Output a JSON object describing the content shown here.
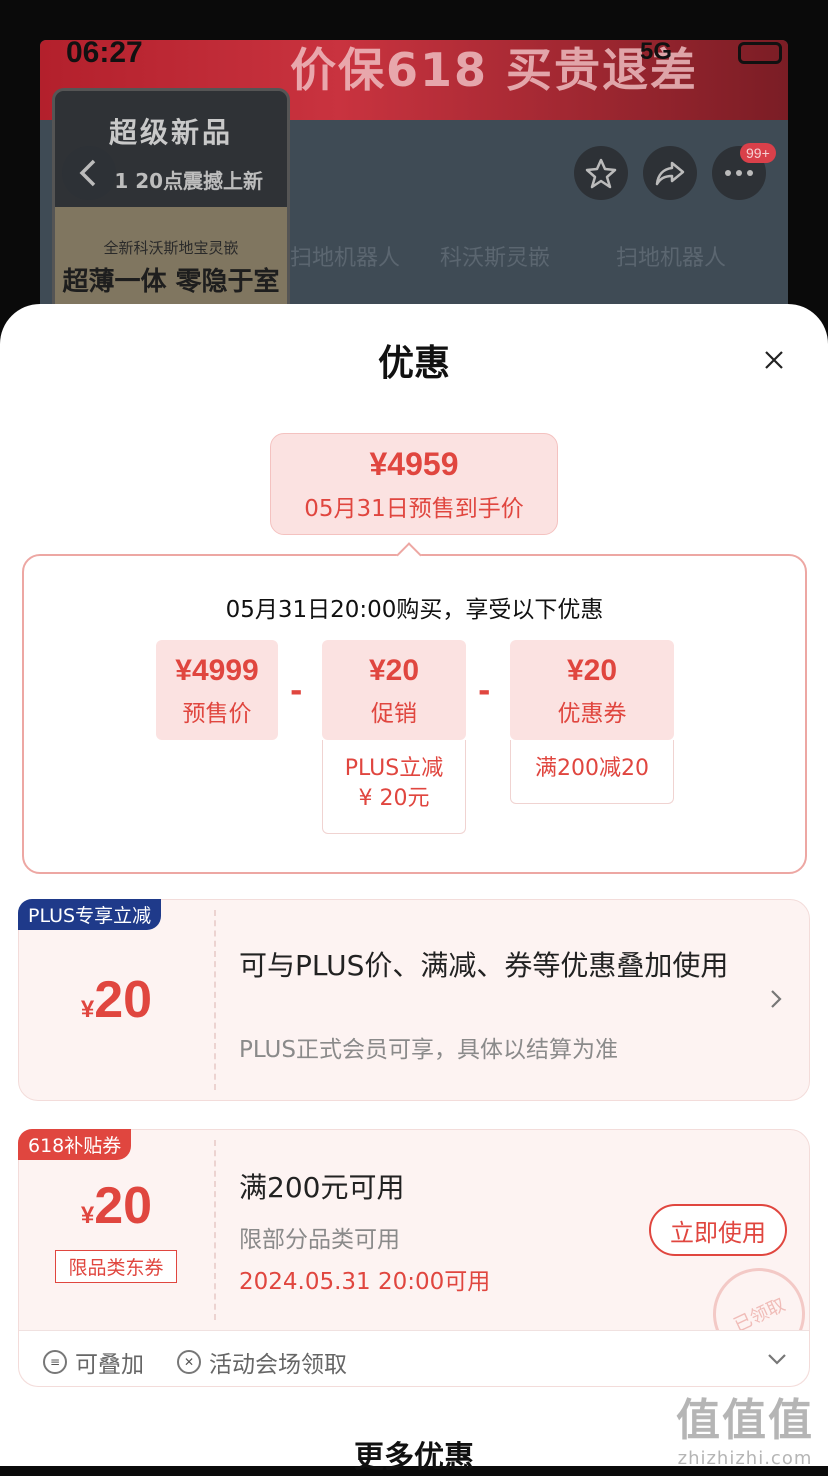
{
  "status_bar": {
    "time": "06:27",
    "network": "5G"
  },
  "background": {
    "banner_text": "价保618 买贵退差",
    "promo_title": "超级新品",
    "promo_sub": "5.31 20点震撼上新",
    "promo_small": "全新科沃斯地宝灵嵌",
    "promo_big": "超薄一体 零隐于室",
    "badge": "99+",
    "tabs": [
      "扫地机器人",
      "科沃斯灵嵌",
      "扫地机器人"
    ]
  },
  "sheet": {
    "title": "优惠",
    "final_price": {
      "amount": "¥4959",
      "label": "05月31日预售到手价"
    },
    "calc": {
      "title": "05月31日20:00购买，享受以下优惠",
      "chips": [
        {
          "amount": "¥4999",
          "label": "预售价"
        },
        {
          "amount": "¥20",
          "label": "促销",
          "note": "PLUS立减\n¥ 20元"
        },
        {
          "amount": "¥20",
          "label": "优惠券",
          "note": "满200减20"
        }
      ],
      "minus": "-"
    },
    "plus_coupon": {
      "tag": "PLUS专享立减",
      "currency": "¥",
      "amount": "20",
      "main": "可与PLUS价、满减、券等优惠叠加使用",
      "sub": "PLUS正式会员可享，具体以结算为准"
    },
    "subsidy_coupon": {
      "tag": "618补贴券",
      "currency": "¥",
      "amount": "20",
      "scope": "限品类东券",
      "main": "满200元可用",
      "sub1": "限部分品类可用",
      "date": "2024.05.31 20:00可用",
      "button": "立即使用",
      "stamp": "已领取",
      "foot_stack": "可叠加",
      "foot_source": "活动会场领取"
    },
    "more_title": "更多优惠"
  },
  "watermark": {
    "big": "值值值",
    "small": "zhizhizhi.com"
  },
  "colors": {
    "accent": "#e0463f",
    "plus_tag": "#1f3a8a",
    "subsidy_tag": "#e0463f"
  }
}
